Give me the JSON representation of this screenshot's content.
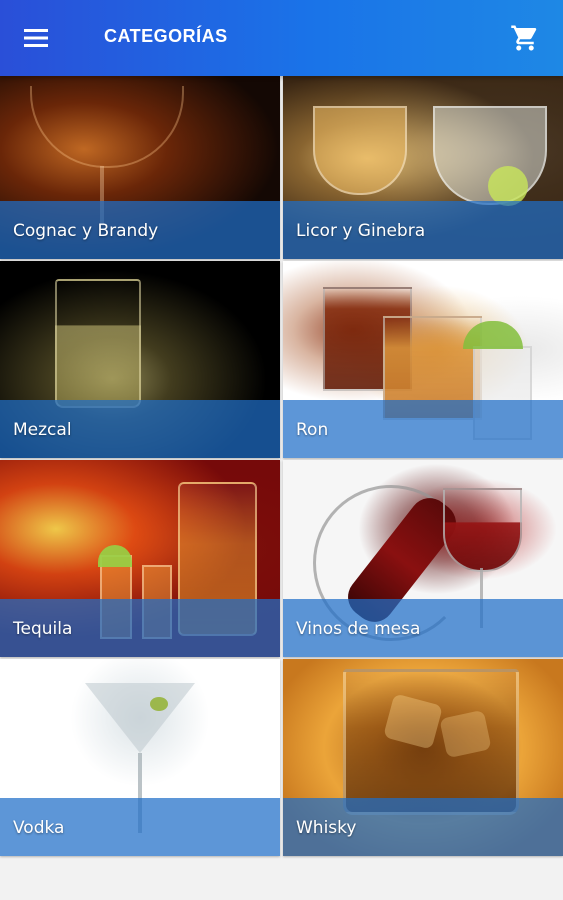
{
  "app_bar": {
    "title": "CATEGORÍAS",
    "menu_icon": "hamburger-menu-icon",
    "cart_icon": "shopping-cart-icon",
    "accent_color": "#1a73e8"
  },
  "categories": [
    {
      "label": "Cognac y Brandy"
    },
    {
      "label": "Licor y Ginebra"
    },
    {
      "label": "Mezcal"
    },
    {
      "label": "Ron"
    },
    {
      "label": "Tequila"
    },
    {
      "label": "Vinos de mesa"
    },
    {
      "label": "Vodka"
    },
    {
      "label": "Whisky"
    }
  ]
}
